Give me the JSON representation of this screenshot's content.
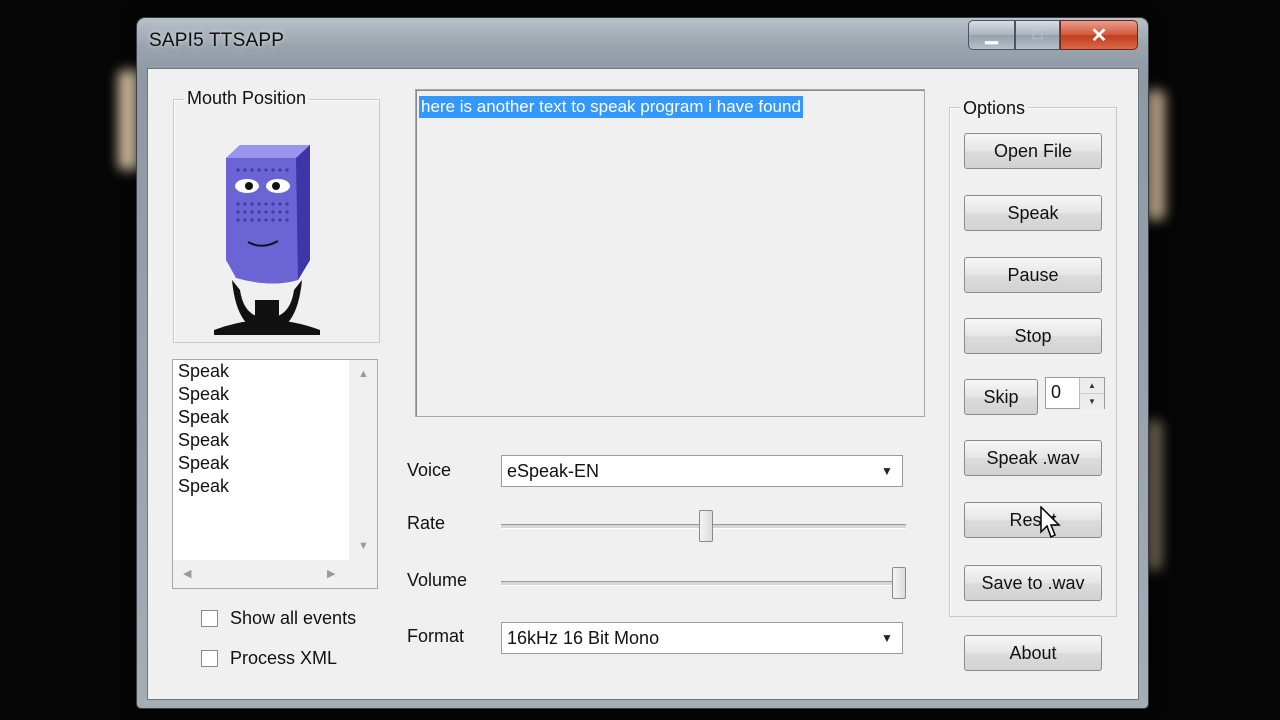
{
  "window": {
    "title": "SAPI5 TTSAPP",
    "minimize_icon": "minimize-icon",
    "maximize_icon": "maximize-icon",
    "close_icon": "close-icon",
    "min_glyph": "▁",
    "max_glyph": "□",
    "close_glyph": "✕"
  },
  "mouth_position": {
    "label": "Mouth Position",
    "icon": "microphone-face-icon"
  },
  "text_input": {
    "value": "here is another text to speak program i have found",
    "selection_color": "#3399ff"
  },
  "event_list": {
    "items": [
      "Speak",
      "Speak",
      "Speak",
      "Speak",
      "Speak",
      "Speak"
    ]
  },
  "checkboxes": {
    "show_all_events": "Show all events",
    "process_xml": "Process XML"
  },
  "voice": {
    "label": "Voice",
    "value": "eSpeak-EN"
  },
  "rate": {
    "label": "Rate",
    "level": 0.5
  },
  "volume": {
    "label": "Volume",
    "level": 1.0
  },
  "format": {
    "label": "Format",
    "value": "16kHz 16 Bit Mono"
  },
  "options": {
    "label": "Options",
    "open_file": "Open File",
    "speak": "Speak",
    "pause": "Pause",
    "stop": "Stop",
    "skip": "Skip",
    "skip_value": "0",
    "speak_wav": "Speak .wav",
    "reset": "Reset",
    "save_wav": "Save to .wav"
  },
  "about": "About"
}
